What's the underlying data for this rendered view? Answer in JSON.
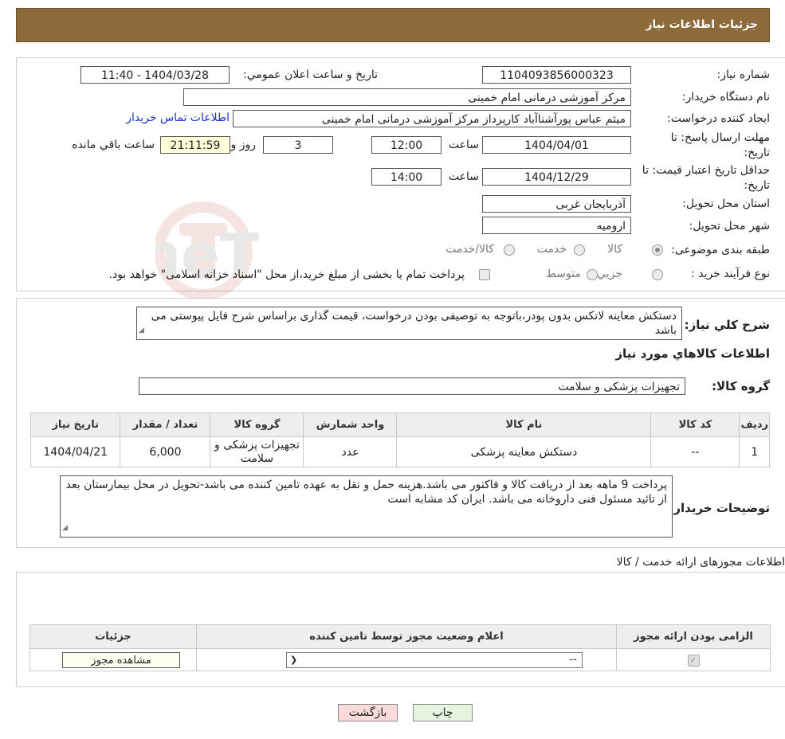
{
  "header": {
    "title": "جزئیات اطلاعات نیاز"
  },
  "form": {
    "need_number_label": "شماره نیاز:",
    "need_number": "1104093856000323",
    "announce_label": "تاریخ و ساعت اعلان عمومي:",
    "announce_value": "1404/03/28 - 11:40",
    "buyer_org_label": "نام دستگاه خريدار:",
    "buyer_org": "مرکز آموزشی درمانی امام خمینی",
    "creator_label": "ايجاد كننده درخواست:",
    "creator": "میثم عباس پورآشناآباد کارپرداز مرکز آموزشی درمانی امام خمینی",
    "contact_link": "اطلاعات تماس خريدار",
    "reply_deadline_label": "مهلت ارسال پاسخ: تا تاریخ:",
    "reply_date": "1404/04/01",
    "time_label": "ساعت",
    "reply_time": "12:00",
    "days_value": "3",
    "days_label": "روز و",
    "remaining_value": "21:11:59",
    "remaining_label": "ساعت باقي مانده",
    "price_validity_label": "حداقل تاريخ اعتبار قيمت: تا تاریخ:",
    "price_date": "1404/12/29",
    "price_time": "14:00",
    "province_label": "استان محل تحويل:",
    "province": "آذربایجان غربی",
    "city_label": "شهر محل تحويل:",
    "city": "ارومیه",
    "category_label": "طبقه بندی موضوعی:",
    "category_options": [
      "کالا",
      "خدمت",
      "کالا/خدمت"
    ],
    "category_selected": "کالا",
    "process_label": "نوع فرآيند خريد :",
    "process_options": [
      "جزيي",
      "متوسط"
    ],
    "process_note": "پرداخت تمام یا بخشی از مبلغ خرید،از محل \"اسناد خزانه اسلامی\" خواهد بود."
  },
  "need_description": {
    "label": "شرح كلي نياز:",
    "text": "دستکش معاینه لاتکس بدون پودر،باتوجه به توصیفی بودن درخواست، قیمت گذاری براساس شرح فایل پیوستی می باشد"
  },
  "goods": {
    "section_title": "اطلاعات كالاهاي مورد نياز",
    "group_label": "گروه کالا:",
    "group_value": "تجهیزات پزشکی و سلامت",
    "columns": [
      "رديف",
      "کد کالا",
      "نام کالا",
      "واحد شمارش",
      "گروه کالا",
      "تعداد / مقدار",
      "تاریخ نیاز"
    ],
    "rows": [
      {
        "row": "1",
        "code": "--",
        "name": "دستکش معاینه پزشکی",
        "unit": "عدد",
        "group": "تجهیزات پزشکی و سلامت",
        "qty": "6,000",
        "date": "1404/04/21"
      }
    ]
  },
  "buyer_notes": {
    "label": "توضيحات خريدار:",
    "text": "پرداخت  9  ماهه  بعد از دریافت کالا و فاکتور می باشد.هزینه حمل و نقل به عهده تامین کننده می باشد-تحویل در محل بیمارستان بعد از تائید مسئول فنی داروخانه می باشد. ایران کد مشابه است"
  },
  "licenses": {
    "section_title": "اطلاعات مجوزهای ارائه خدمت / کالا",
    "columns": [
      "الزامی بودن ارائه مجوز",
      "اعلام وضعیت مجوز توسط تامین کننده",
      "جزئیات"
    ],
    "select_value": "--",
    "view_button": "مشاهده مجوز"
  },
  "buttons": {
    "print": "چاپ",
    "back": "بازگشت"
  },
  "watermark": {
    "text": "AriaTender.neT"
  },
  "colors": {
    "header_bg": "#8c6a3a",
    "link": "#1a35c9",
    "back_btn": "#fbdada",
    "print_btn": "#e6f5e0"
  }
}
